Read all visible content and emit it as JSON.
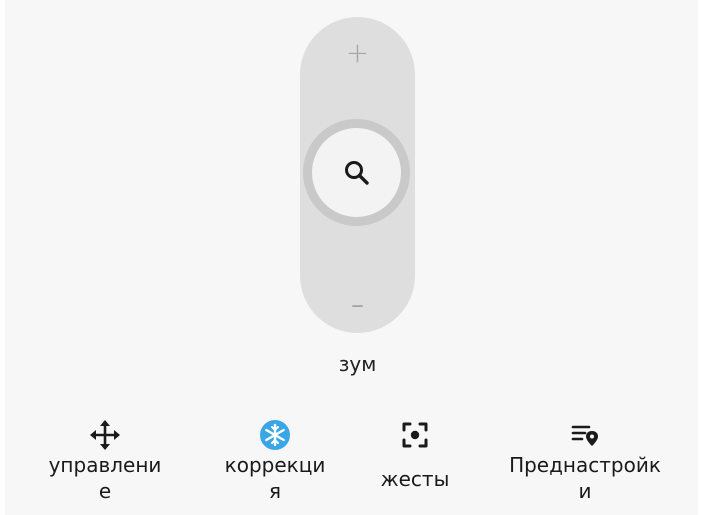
{
  "zoom": {
    "plus_label": "+",
    "minus_label": "–",
    "label": "зум",
    "knob_icon": "search-icon"
  },
  "tabs": [
    {
      "label_line1": "управлени",
      "label_line2": "е",
      "icon": "move-arrows-icon",
      "color": "#1a1a1a"
    },
    {
      "label_line1": "коррекци",
      "label_line2": "я",
      "icon": "snowflake-icon",
      "color": "#3aa6e8"
    },
    {
      "label_line1": "жесты",
      "label_line2": "",
      "icon": "focus-frame-icon",
      "color": "#1a1a1a"
    },
    {
      "label_line1": "Преднастройк",
      "label_line2": "и",
      "icon": "preset-list-pin-icon",
      "color": "#1a1a1a"
    }
  ]
}
